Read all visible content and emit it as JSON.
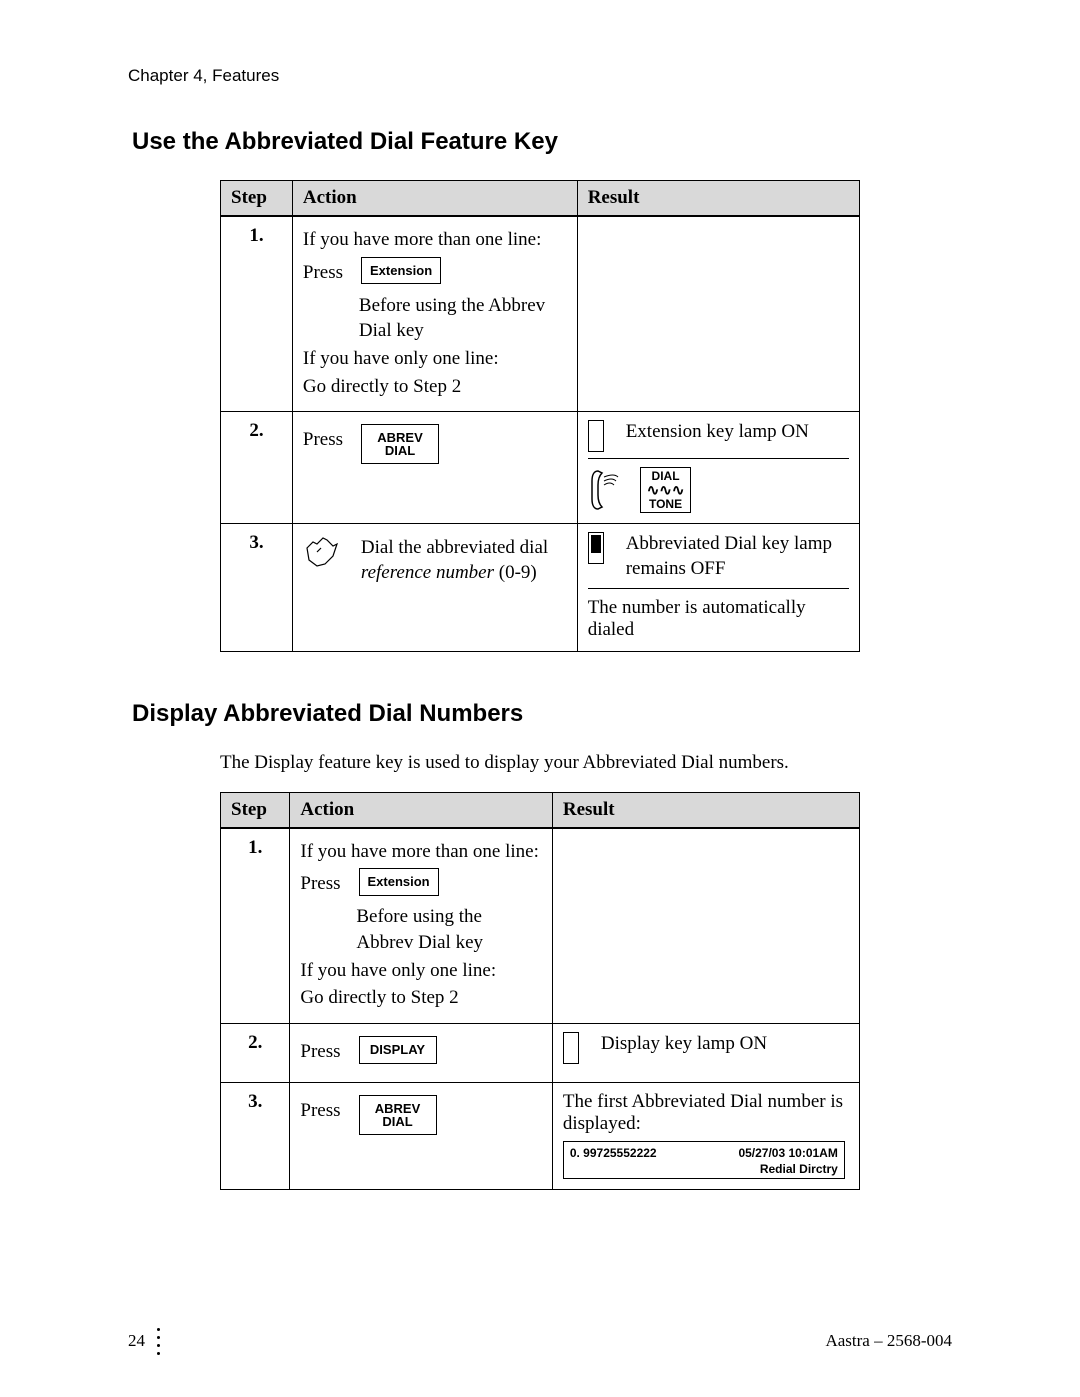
{
  "chapter_header": "Chapter 4, Features",
  "section1": {
    "heading": "Use the Abbreviated Dial Feature Key",
    "table": {
      "headers": {
        "step": "Step",
        "action": "Action",
        "result": "Result"
      },
      "rows": [
        {
          "step": "1.",
          "a_line1": "If you have more than one line:",
          "a_press": "Press",
          "a_key": "Extension",
          "a_line2": "Before using the Abbrev Dial key",
          "a_line3": "If you have only one line:",
          "a_line4": "Go directly to Step 2"
        },
        {
          "step": "2.",
          "a_press": "Press",
          "a_key1": "ABREV",
          "a_key2": "DIAL",
          "r_line1": "Extension key lamp ON",
          "r_tone1": "DIAL",
          "r_tone2": "TONE"
        },
        {
          "step": "3.",
          "a_text": "Dial the abbreviated dial ",
          "a_em": "reference number",
          "a_tail": " (0-9)",
          "r_line1": "Abbreviated Dial key lamp remains OFF",
          "r_line2": "The number is automatically dialed"
        }
      ]
    }
  },
  "section2": {
    "heading": "Display Abbreviated Dial Numbers",
    "intro": "The Display feature key is used to display your Abbreviated Dial numbers.",
    "table": {
      "headers": {
        "step": "Step",
        "action": "Action",
        "result": "Result"
      },
      "rows": [
        {
          "step": "1.",
          "a_line1": "If you have more than one line:",
          "a_press": "Press",
          "a_key": "Extension",
          "a_line2": "Before using the Abbrev Dial key",
          "a_line3": "If you have only one line:",
          "a_line4": "Go directly to Step 2"
        },
        {
          "step": "2.",
          "a_press": "Press",
          "a_key": "DISPLAY",
          "r_line1": "Display key lamp ON"
        },
        {
          "step": "3.",
          "a_press": "Press",
          "a_key1": "ABREV",
          "a_key2": "DIAL",
          "r_line1": "The first Abbreviated Dial number is displayed:",
          "lcd": {
            "num": "0. 99725552222",
            "ts": "05/27/03 10:01AM",
            "soft": "Redial   Dirctry"
          }
        }
      ]
    }
  },
  "footer": {
    "page": "24",
    "doc": "Aastra – 2568-004"
  }
}
